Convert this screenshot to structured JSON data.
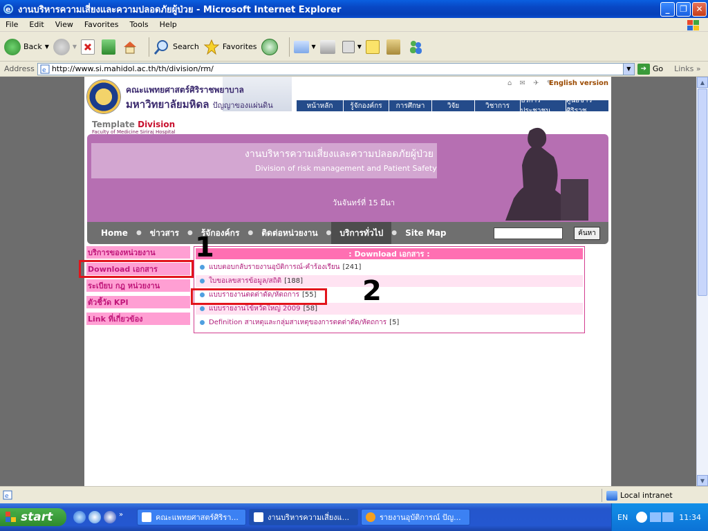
{
  "window": {
    "title": "งานบริหารความเสี่ยงและความปลอดภัยผู้ป่วย - Microsoft Internet Explorer",
    "minimize": "_",
    "maximize": "❐",
    "close": "✕"
  },
  "menubar": [
    "File",
    "Edit",
    "View",
    "Favorites",
    "Tools",
    "Help"
  ],
  "toolbar": {
    "back": "Back",
    "search": "Search",
    "favorites": "Favorites"
  },
  "address": {
    "label": "Address",
    "url": "http://www.si.mahidol.ac.th/th/division/rm/",
    "go": "Go",
    "links": "Links"
  },
  "site": {
    "faculty": "คณะแพทยศาสตร์ศิริราชพยาบาล",
    "university": "มหาวิทยาลัยมหิดล",
    "motto": "ปัญญาของแผ่นดิน",
    "english": "English version",
    "topnav": [
      "หน้าหลัก",
      "รู้จักองค์กร",
      "การศึกษา",
      "วิจัย",
      "วิชาการ",
      "บริการประชาชน",
      "ศูนย์ข่าวศิริราช"
    ],
    "template": "Template",
    "division": "Division",
    "template_sub": "Faculty of Medicine Siriraj Hospital",
    "banner_th": "งานบริหารความเสี่ยงและความปลอดภัยผู้ป่วย",
    "banner_en": "Division of risk management and Patient Safety",
    "date": "วันจันทร์ที่ 15 มีนา",
    "mainnav": [
      "Home",
      "ข่าวสาร",
      "รู้จักองค์กร",
      "ติดต่อหน่วยงาน",
      "บริการทั่วไป",
      "Site Map"
    ],
    "search_button": "ค้นหา"
  },
  "leftmenu": [
    "บริการของหน่วยงาน",
    "Download เอกสาร",
    "ระเบียบ กฎ หน่วยงาน",
    "ตัวชี้วัด KPI",
    "Link ที่เกี่ยวข้อง"
  ],
  "downloads": {
    "header": ": Download เอกสาร :",
    "items": [
      {
        "label": "แบบตอบกลับรายงานอุบัติการณ์-คำร้องเรียน",
        "count": "[241]"
      },
      {
        "label": "ใบขอเลขสารข้อมูล/สถิติ",
        "count": "[188]"
      },
      {
        "label": "แบบรายงานตดต่าดัด/หัตถการ",
        "count": "[55]"
      },
      {
        "label": "แบบรายงานไข้หวัดใหญ่ 2009",
        "count": "[58]"
      },
      {
        "label": "Definition สาเหตุและกลุ่มสาเหตุของการตดต่าดัด/หัตถการ",
        "count": "[5]"
      }
    ]
  },
  "annotations": {
    "one": "1",
    "two": "2"
  },
  "status": {
    "zone": "Local intranet"
  },
  "taskbar": {
    "start": "start",
    "tasks": [
      "คณะแพทยศาสตร์ศิริรา...",
      "งานบริหารความเสี่ยงแ...",
      "รายงานอุบัติการณ์ ปัญ..."
    ],
    "lang": "EN",
    "clock": "11:34"
  },
  "colors": {
    "accent": "#ff9fd3",
    "banner": "#b66fb2",
    "title": "#0847c4"
  }
}
